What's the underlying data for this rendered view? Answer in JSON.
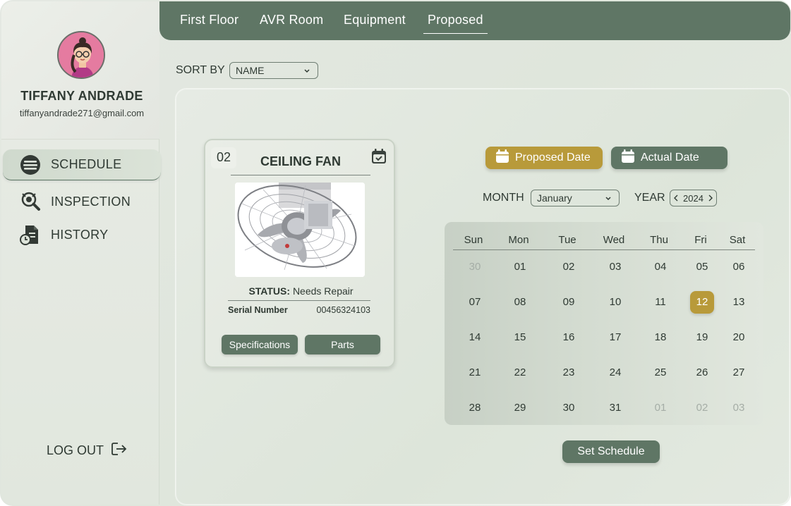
{
  "profile": {
    "name": "TIFFANY ANDRADE",
    "email": "tiffanyandrade271@gmail.com"
  },
  "sidebar": {
    "items": [
      {
        "label": "SCHEDULE",
        "icon": "schedule-icon",
        "active": true
      },
      {
        "label": "INSPECTION",
        "icon": "inspection-icon",
        "active": false
      },
      {
        "label": "HISTORY",
        "icon": "history-icon",
        "active": false
      }
    ],
    "logout_label": "LOG OUT"
  },
  "breadcrumb": [
    "First Floor",
    "AVR Room",
    "Equipment",
    "Proposed"
  ],
  "sort": {
    "label": "SORT BY",
    "value": "NAME"
  },
  "card": {
    "number": "02",
    "title": "CEILING FAN",
    "status_label": "STATUS:",
    "status_value": "Needs Repair",
    "serial_label": "Serial Number",
    "serial_value": "00456324103",
    "specs_label": "Specifications",
    "parts_label": "Parts"
  },
  "date_toggle": {
    "proposed_label": "Proposed Date",
    "actual_label": "Actual Date"
  },
  "month": {
    "label": "MONTH",
    "value": "January"
  },
  "year": {
    "label": "YEAR",
    "value": "2024"
  },
  "calendar": {
    "weekdays": [
      "Sun",
      "Mon",
      "Tue",
      "Wed",
      "Thu",
      "Fri",
      "Sat"
    ],
    "weeks": [
      [
        "30",
        "01",
        "02",
        "03",
        "04",
        "05",
        "06"
      ],
      [
        "07",
        "08",
        "09",
        "10",
        "11",
        "12",
        "13"
      ],
      [
        "14",
        "15",
        "16",
        "17",
        "18",
        "19",
        "20"
      ],
      [
        "21",
        "22",
        "23",
        "24",
        "25",
        "26",
        "27"
      ],
      [
        "28",
        "29",
        "30",
        "31",
        "01",
        "02",
        "03"
      ]
    ],
    "selected": "12"
  },
  "set_schedule_label": "Set Schedule",
  "colors": {
    "accent_green": "#5f7665",
    "accent_gold": "#b89a3a",
    "avatar_bg": "#e57ba0"
  }
}
